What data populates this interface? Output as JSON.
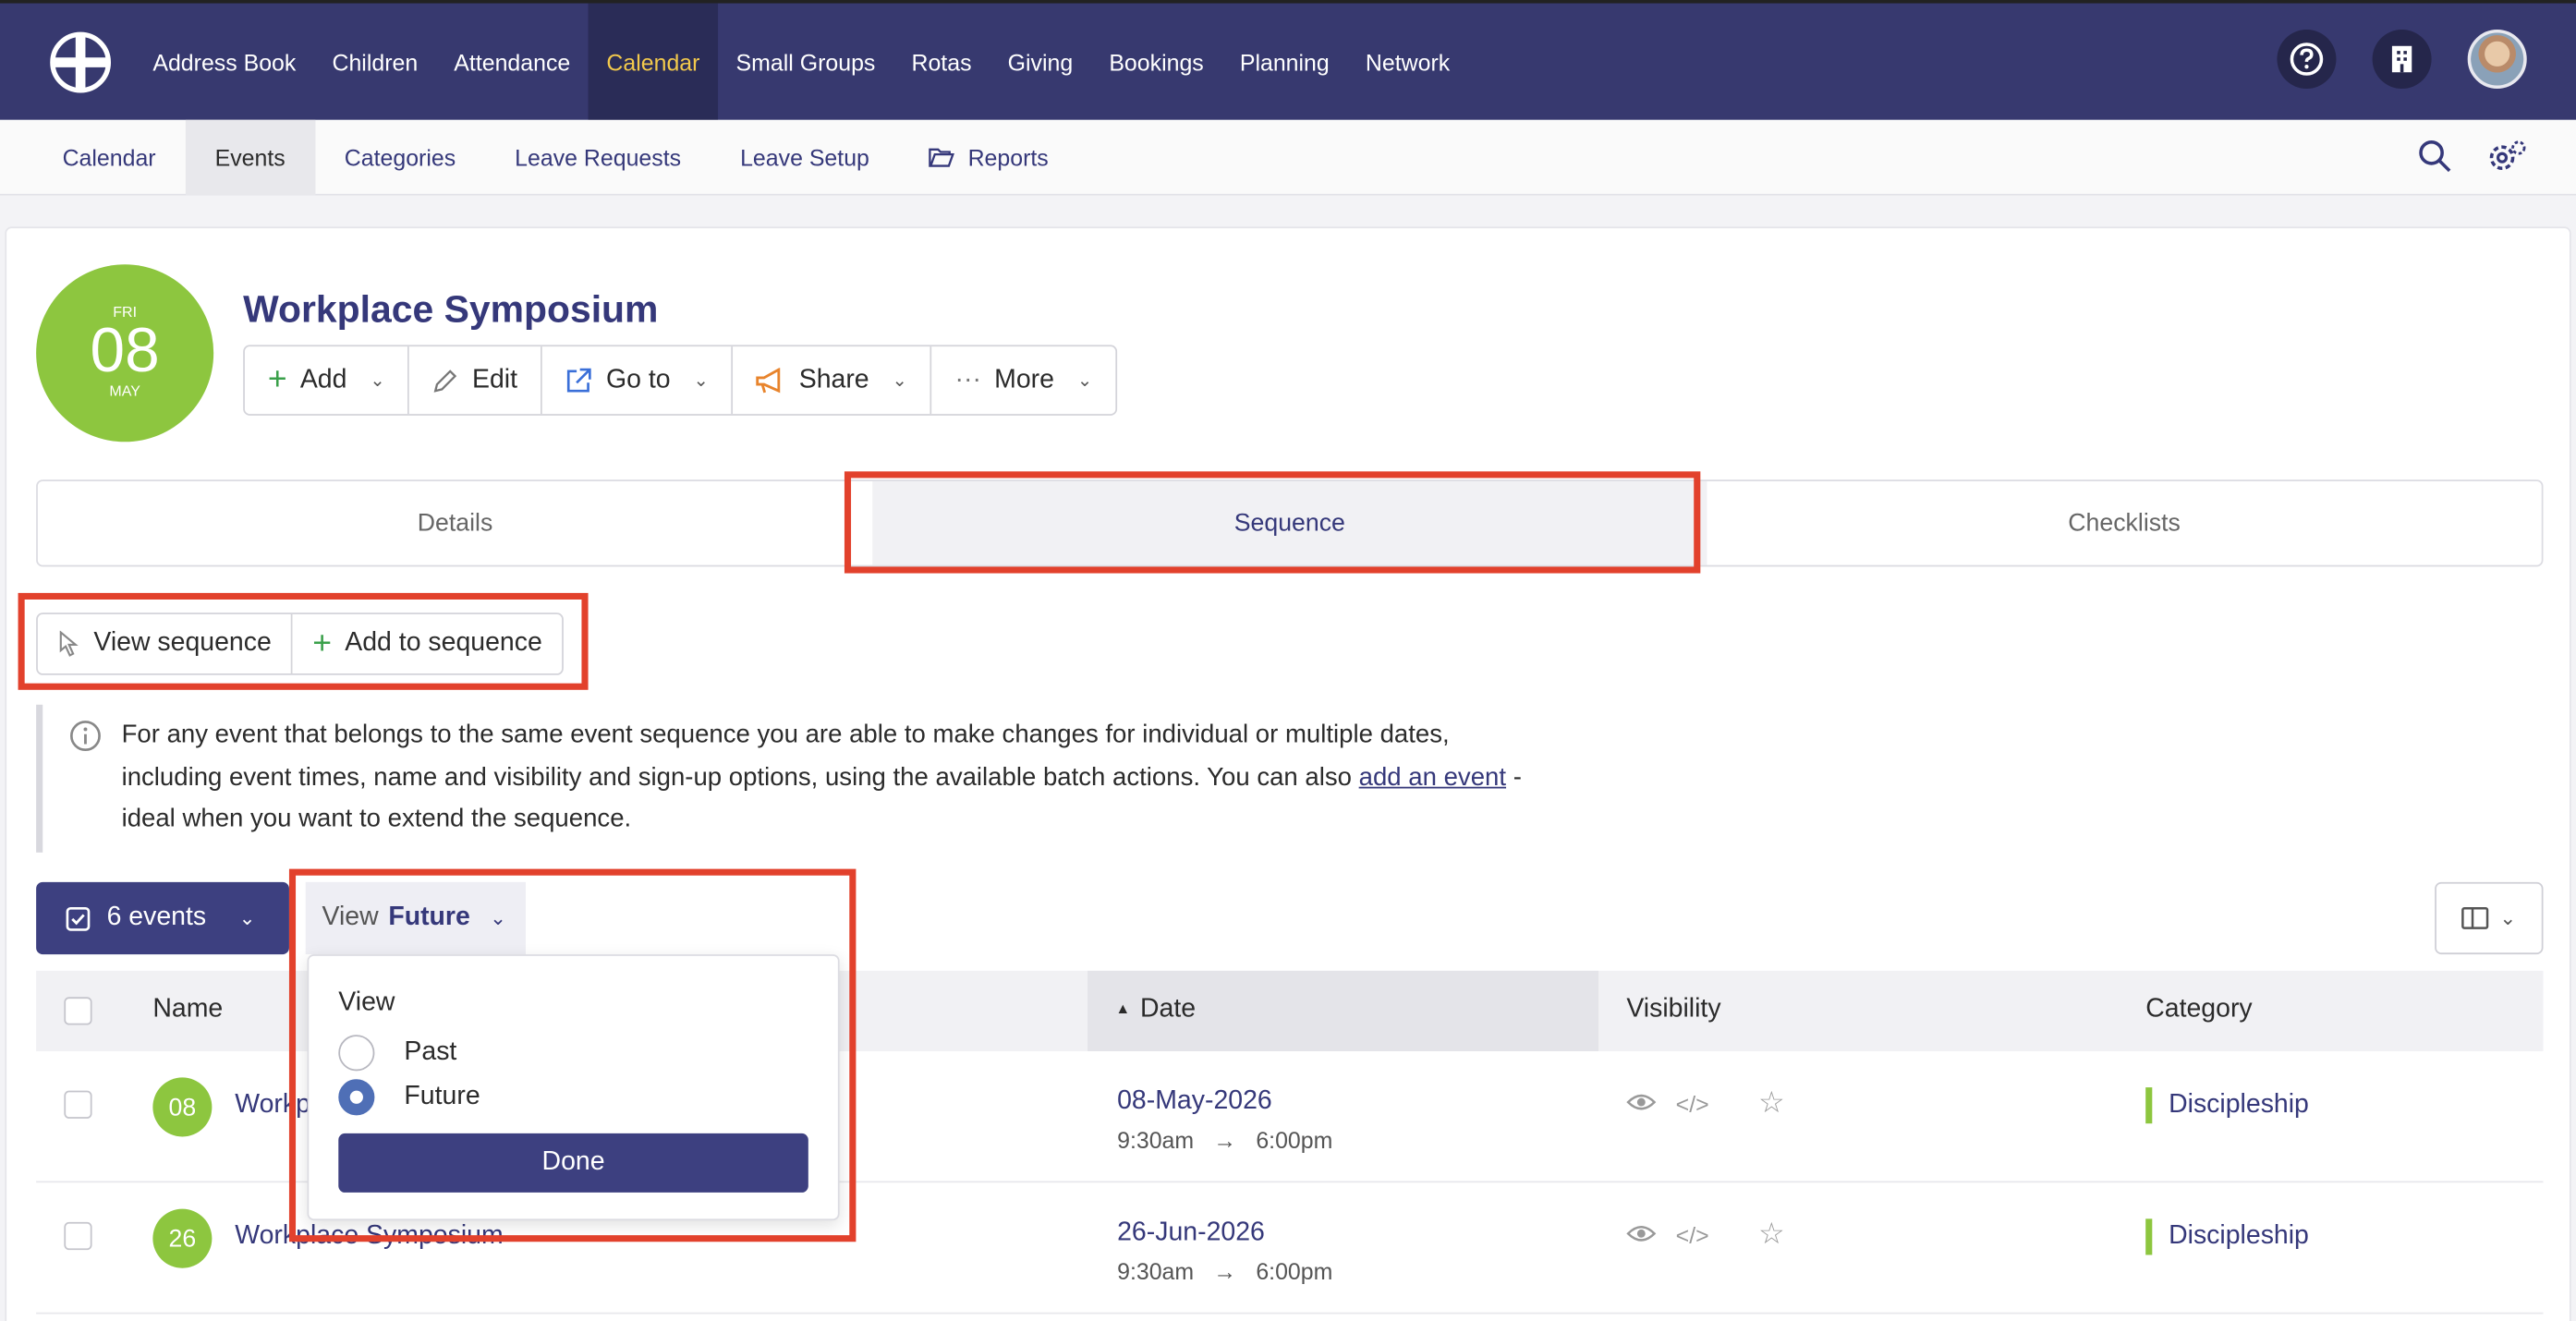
{
  "topnav": {
    "items": [
      "Address Book",
      "Children",
      "Attendance",
      "Calendar",
      "Small Groups",
      "Rotas",
      "Giving",
      "Bookings",
      "Planning",
      "Network"
    ],
    "active": "Calendar",
    "help_icon": "question-icon",
    "org_icon": "building-icon"
  },
  "subnav": {
    "items": [
      "Calendar",
      "Events",
      "Categories",
      "Leave Requests",
      "Leave Setup",
      "Reports"
    ],
    "active": "Events"
  },
  "event": {
    "weekday": "FRI",
    "day": "08",
    "month": "MAY",
    "title": "Workplace Symposium"
  },
  "actions": {
    "add": "Add",
    "edit": "Edit",
    "goto": "Go to",
    "share": "Share",
    "more": "More"
  },
  "tabs": {
    "details": "Details",
    "sequence": "Sequence",
    "checklists": "Checklists"
  },
  "sequence": {
    "view_label": "View sequence",
    "add_label": "Add to sequence"
  },
  "info": {
    "text_before": "For any event that belongs to the same event sequence you are able to make changes for individual or multiple dates, including event times, name and visibility and sign-up options, using the available batch actions. You can also ",
    "link": "add an event",
    "text_after": " - ideal when you want to extend the sequence."
  },
  "toolbar": {
    "events_count": "6 events",
    "view_prefix": "View",
    "view_value": "Future"
  },
  "table": {
    "headers": {
      "name": "Name",
      "date": "Date",
      "visibility": "Visibility",
      "category": "Category"
    },
    "rows": [
      {
        "badge": "08",
        "name": "Workplace Symposium",
        "date": "08-May-2026",
        "start": "9:30am",
        "end": "6:00pm",
        "category": "Discipleship"
      },
      {
        "badge": "26",
        "name": "Workplace Symposium",
        "date": "26-Jun-2026",
        "start": "9:30am",
        "end": "6:00pm",
        "category": "Discipleship"
      }
    ]
  },
  "popup": {
    "title": "View",
    "options": [
      "Past",
      "Future"
    ],
    "selected": "Future",
    "done": "Done"
  },
  "colors": {
    "nav_bg": "#37396f",
    "accent_yellow": "#f2c94c",
    "event_green": "#8dc63f",
    "primary_button": "#3d4080",
    "highlight_red": "#e2412c"
  }
}
